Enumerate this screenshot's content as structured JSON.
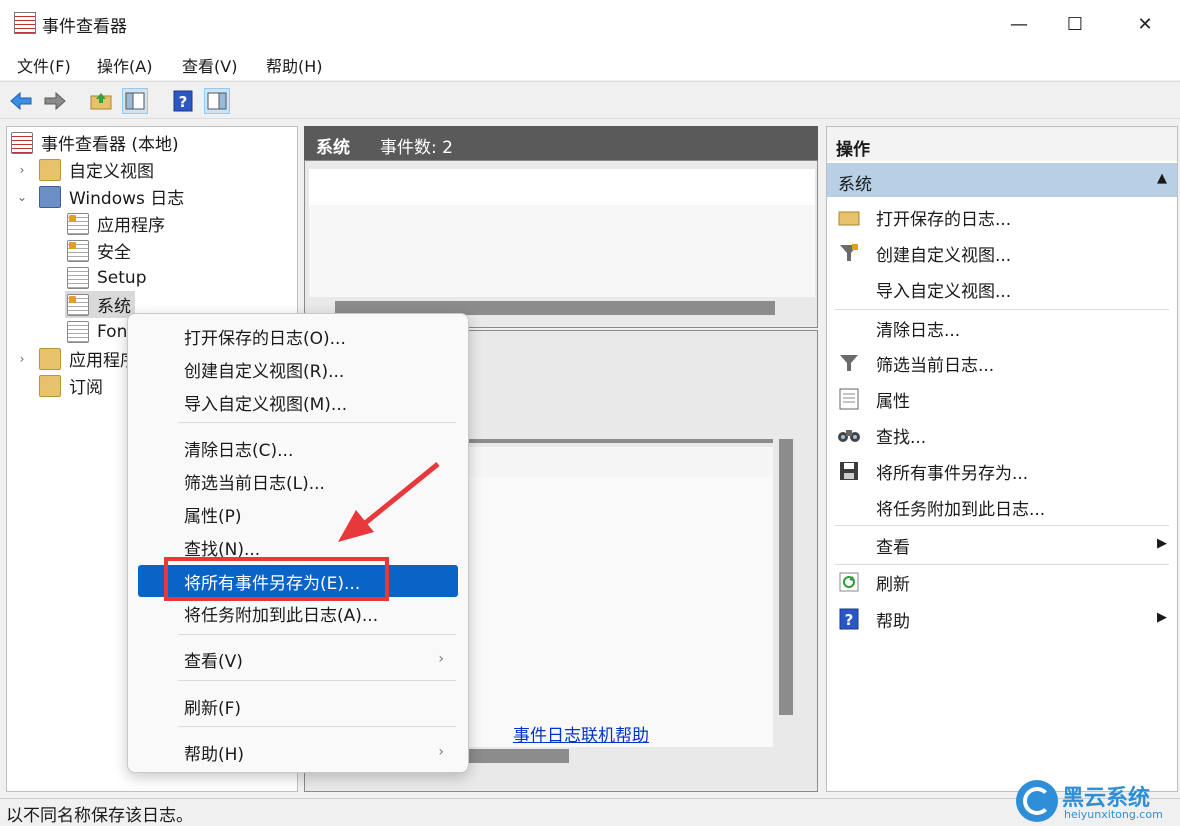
{
  "window": {
    "title": "事件查看器",
    "minimize": "—",
    "maximize": "☐",
    "close": "✕"
  },
  "menu": [
    "文件(F)",
    "操作(A)",
    "查看(V)",
    "帮助(H)"
  ],
  "tree": {
    "root": "事件查看器 (本地)",
    "custom_views": "自定义视图",
    "windows_logs": "Windows 日志",
    "application": "应用程序",
    "security": "安全",
    "setup": "Setup",
    "system": "系统",
    "forwarded": "Fon",
    "apps_services": "应用程序",
    "subscriptions": "订阅"
  },
  "center": {
    "title": "系统",
    "count_label": "事件数: 2",
    "help_link": "事件日志联机帮助"
  },
  "actions": {
    "header": "操作",
    "group": "系统",
    "items": [
      "打开保存的日志...",
      "创建自定义视图...",
      "导入自定义视图...",
      "清除日志...",
      "筛选当前日志...",
      "属性",
      "查找...",
      "将所有事件另存为...",
      "将任务附加到此日志...",
      "查看",
      "刷新",
      "帮助"
    ]
  },
  "context_menu": {
    "items": [
      "打开保存的日志(O)...",
      "创建自定义视图(R)...",
      "导入自定义视图(M)...",
      "清除日志(C)...",
      "筛选当前日志(L)...",
      "属性(P)",
      "查找(N)...",
      "将所有事件另存为(E)...",
      "将任务附加到此日志(A)...",
      "查看(V)",
      "刷新(F)",
      "帮助(H)"
    ],
    "highlighted": "将所有事件另存为(E)..."
  },
  "status_bar": "以不同名称保存该日志。",
  "watermark": {
    "name": "黑云系统",
    "url": "heiyunxitong.com"
  },
  "colors": {
    "highlight": "#0a64c8",
    "annotation": "#e8383c",
    "link": "#0033cc"
  }
}
